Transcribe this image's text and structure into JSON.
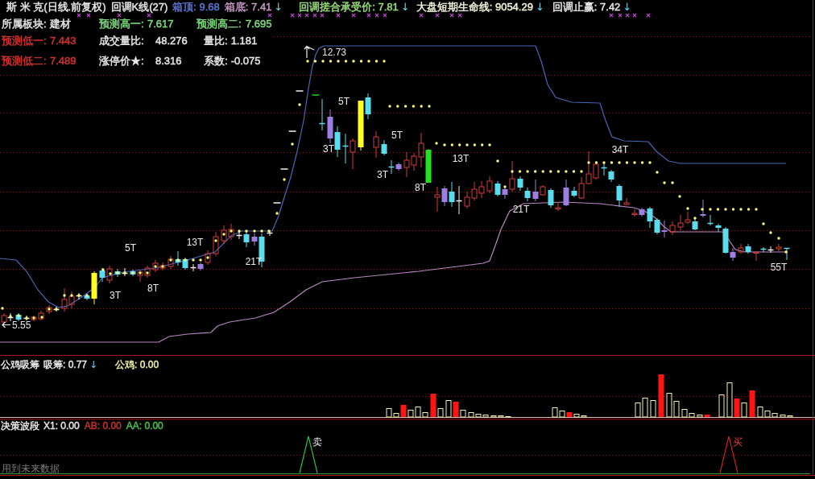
{
  "main_panel": {
    "header_lines": [
      {
        "items": [
          {
            "text": "斯 米 克(日线.前复权)",
            "color": "#e8e8e8"
          },
          {
            "text": "回调K线(27)",
            "color": "#e8e8e8"
          },
          {
            "text": "箱顶: 9.68",
            "color": "#5a78d6"
          },
          {
            "text": "箱底: 7.41",
            "color": "#c89ac8",
            "arrow": "↓"
          },
          {
            "text": "回调搓合承受价: 7.81",
            "color": "#98e078",
            "arrow": "↓"
          },
          {
            "text": "大盘短期生命线: 9054.29",
            "color": "#f4f4dc",
            "arrow": "↓"
          },
          {
            "text": "回调止赢: 7.42",
            "color": "#e8e8e8",
            "arrow": "↓"
          }
        ]
      },
      {
        "items": [
          {
            "label": "所属板块:",
            "value": "建材",
            "color": "#e8e8e8"
          },
          {
            "label": "预测高一:",
            "value": "7.617",
            "color": "#7fe07f"
          },
          {
            "label": "预测高二:",
            "value": "7.695",
            "color": "#7fe07f"
          }
        ]
      },
      {
        "items": [
          {
            "label": "预测低一:",
            "value": "7.443",
            "color": "#d83030"
          },
          {
            "label": "成交量比:",
            "value": "48.276",
            "color": "#e8e8e8"
          },
          {
            "label": "量比:",
            "value": "1.181",
            "color": "#e8e8e8"
          }
        ]
      },
      {
        "items": [
          {
            "label": "预测低二:",
            "value": "7.489",
            "color": "#d83030"
          },
          {
            "label": "涨停价★:",
            "value": "8.316",
            "color": "#e8e8e8"
          },
          {
            "label": "系数:",
            "value": "-0.075",
            "color": "#e8e8e8"
          }
        ]
      }
    ],
    "price_marks": [
      {
        "kind": "high",
        "text": "12.73"
      },
      {
        "kind": "low",
        "text": "5.55"
      }
    ],
    "cycle_labels": [
      {
        "text": "5T"
      },
      {
        "text": "3T"
      },
      {
        "text": "8T"
      },
      {
        "text": "13T"
      },
      {
        "text": "21T"
      },
      {
        "text": "3T"
      },
      {
        "text": "5T"
      },
      {
        "text": "5T"
      },
      {
        "text": "3T"
      },
      {
        "text": "8T"
      },
      {
        "text": "13T"
      },
      {
        "text": "21T"
      },
      {
        "text": "34T"
      },
      {
        "text": "55T"
      }
    ]
  },
  "accumulation_panel": {
    "title": "公鸡吸筹",
    "readings": [
      {
        "text": "吸筹: 0.77",
        "color": "#e8e8e8",
        "arrow": "↓"
      },
      {
        "text": "公鸡: 0.00",
        "color": "#f0f0a8"
      }
    ]
  },
  "decision_panel": {
    "title": "决策波段",
    "readings": [
      {
        "text": "X1: 0.00",
        "color": "#e8e8e8"
      },
      {
        "text": "AB: 0.00",
        "color": "#c83030"
      },
      {
        "text": "AA: 0.00",
        "color": "#48c048"
      }
    ],
    "signals": [
      {
        "kind": "sell",
        "text": "卖"
      },
      {
        "kind": "buy",
        "text": "买"
      }
    ],
    "note": "用到未来数据"
  }
}
